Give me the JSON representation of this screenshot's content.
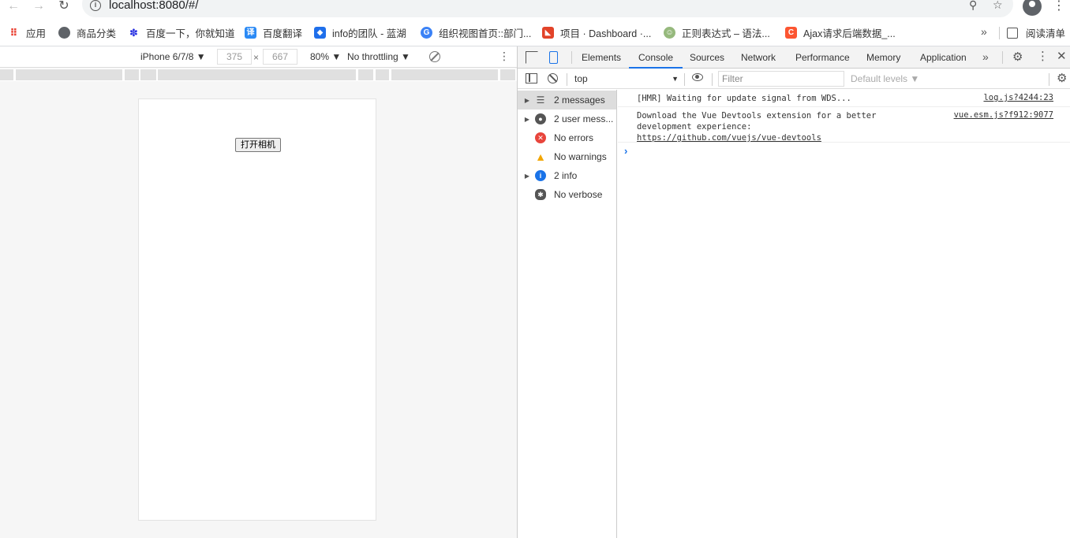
{
  "browser": {
    "url": "localhost:8080/#/",
    "bookmarks": [
      {
        "label": "应用",
        "icon": "apps-grid-icon",
        "color": "#ea4335"
      },
      {
        "label": "商品分类",
        "icon": "globe-icon",
        "color": "#5f6368"
      },
      {
        "label": "百度一下，你就知道",
        "icon": "baidu-paw-icon",
        "color": "#2932e1"
      },
      {
        "label": "百度翻译",
        "icon": "baidu-translate-icon",
        "color": "#2b8af5"
      },
      {
        "label": "info的团队 - 蓝湖",
        "icon": "lanhu-icon",
        "color": "#1f6feb"
      },
      {
        "label": "组织视图首页::部门...",
        "icon": "org-view-icon",
        "color": "#3b82f6"
      },
      {
        "label": "项目 · Dashboard ·...",
        "icon": "gitlab-icon",
        "color": "#e24329"
      },
      {
        "label": "正则表达式 – 语法...",
        "icon": "runoob-icon",
        "color": "#96b97d"
      },
      {
        "label": "Ajax请求后端数据_...",
        "icon": "csdn-icon",
        "color": "#fc5531"
      }
    ],
    "more_bookmarks": "»",
    "reading_list": "阅读清单"
  },
  "device_toolbar": {
    "device": "iPhone 6/7/8 ▼",
    "width": "375",
    "times": "×",
    "height": "667",
    "zoom": "80% ▼",
    "throttling": "No throttling ▼"
  },
  "page": {
    "camera_button": "打开相机"
  },
  "devtools": {
    "tabs": [
      "Elements",
      "Console",
      "Sources",
      "Network",
      "Performance",
      "Memory",
      "Application"
    ],
    "active_tab": "Console",
    "more": "»",
    "context": "top",
    "filter_placeholder": "Filter",
    "levels": "Default levels ▼",
    "sidebar": [
      {
        "label": "2 messages",
        "icon": "list-icon",
        "arrow": true,
        "selected": true
      },
      {
        "label": "2 user mess...",
        "icon": "user-icon",
        "arrow": true,
        "selected": false
      },
      {
        "label": "No errors",
        "icon": "error-icon",
        "arrow": false,
        "selected": false
      },
      {
        "label": "No warnings",
        "icon": "warning-icon",
        "arrow": false,
        "selected": false
      },
      {
        "label": "2 info",
        "icon": "info-icon",
        "arrow": true,
        "selected": false
      },
      {
        "label": "No verbose",
        "icon": "bug-icon",
        "arrow": false,
        "selected": false
      }
    ],
    "messages": [
      {
        "text": "[HMR] Waiting for update signal from WDS...",
        "source": "log.js?4244:23"
      },
      {
        "text": "Download the Vue Devtools extension for a better\ndevelopment experience:",
        "link": "https://github.com/vuejs/vue-devtools",
        "source": "vue.esm.js?f912:9077"
      }
    ],
    "prompt": "›"
  }
}
